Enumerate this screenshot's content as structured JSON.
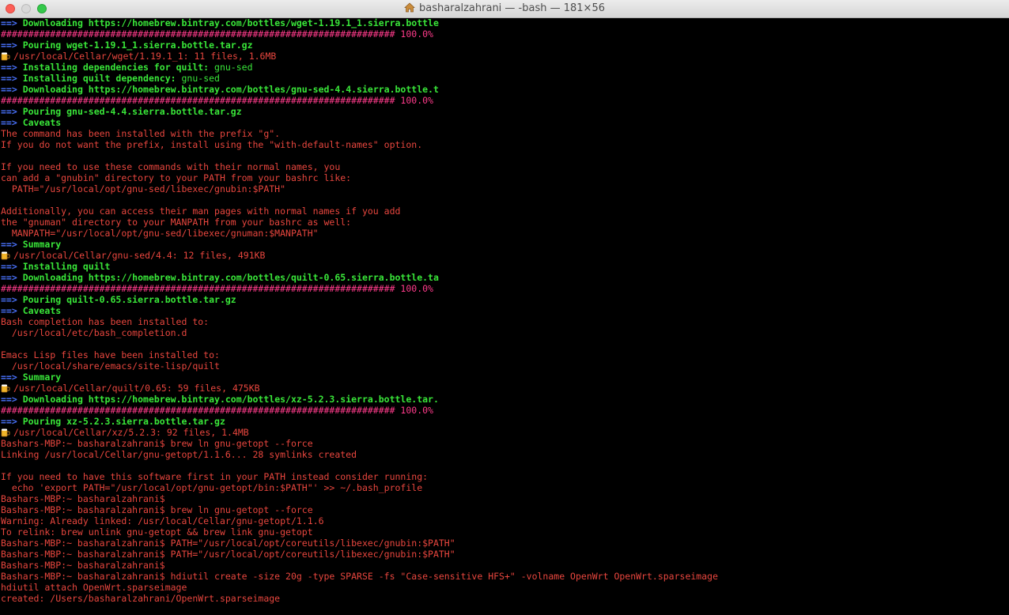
{
  "window": {
    "title": "basharalzahrani — -bash — 181×56"
  },
  "lines": [
    {
      "type": "arrow-green",
      "text": "Downloading https://homebrew.bintray.com/bottles/wget-1.19.1_1.sierra.bottle"
    },
    {
      "type": "hash",
      "text": "######################################################################## 100.0%"
    },
    {
      "type": "arrow-green",
      "text": "Pouring wget-1.19.1_1.sierra.bottle.tar.gz"
    },
    {
      "type": "beer",
      "text": "/usr/local/Cellar/wget/1.19.1_1: 11 files, 1.6MB"
    },
    {
      "type": "arrow-green-mixed",
      "text": "Installing dependencies for quilt:",
      "rest": " gnu-sed"
    },
    {
      "type": "arrow-green-mixed",
      "text": "Installing quilt dependency:",
      "rest": " gnu-sed"
    },
    {
      "type": "arrow-green",
      "text": "Downloading https://homebrew.bintray.com/bottles/gnu-sed-4.4.sierra.bottle.t"
    },
    {
      "type": "hash",
      "text": "######################################################################## 100.0%"
    },
    {
      "type": "arrow-green",
      "text": "Pouring gnu-sed-4.4.sierra.bottle.tar.gz"
    },
    {
      "type": "arrow-green",
      "text": "Caveats"
    },
    {
      "type": "red",
      "text": "The command has been installed with the prefix \"g\"."
    },
    {
      "type": "red",
      "text": "If you do not want the prefix, install using the \"with-default-names\" option."
    },
    {
      "type": "red",
      "text": ""
    },
    {
      "type": "red",
      "text": "If you need to use these commands with their normal names, you"
    },
    {
      "type": "red",
      "text": "can add a \"gnubin\" directory to your PATH from your bashrc like:"
    },
    {
      "type": "red",
      "text": "  PATH=\"/usr/local/opt/gnu-sed/libexec/gnubin:$PATH\""
    },
    {
      "type": "red",
      "text": ""
    },
    {
      "type": "red",
      "text": "Additionally, you can access their man pages with normal names if you add"
    },
    {
      "type": "red",
      "text": "the \"gnuman\" directory to your MANPATH from your bashrc as well:"
    },
    {
      "type": "red",
      "text": "  MANPATH=\"/usr/local/opt/gnu-sed/libexec/gnuman:$MANPATH\""
    },
    {
      "type": "arrow-green",
      "text": "Summary"
    },
    {
      "type": "beer",
      "text": "/usr/local/Cellar/gnu-sed/4.4: 12 files, 491KB"
    },
    {
      "type": "arrow-green",
      "text": "Installing quilt"
    },
    {
      "type": "arrow-green",
      "text": "Downloading https://homebrew.bintray.com/bottles/quilt-0.65.sierra.bottle.ta"
    },
    {
      "type": "hash",
      "text": "######################################################################## 100.0%"
    },
    {
      "type": "arrow-green",
      "text": "Pouring quilt-0.65.sierra.bottle.tar.gz"
    },
    {
      "type": "arrow-green",
      "text": "Caveats"
    },
    {
      "type": "red",
      "text": "Bash completion has been installed to:"
    },
    {
      "type": "red",
      "text": "  /usr/local/etc/bash_completion.d"
    },
    {
      "type": "red",
      "text": ""
    },
    {
      "type": "red",
      "text": "Emacs Lisp files have been installed to:"
    },
    {
      "type": "red",
      "text": "  /usr/local/share/emacs/site-lisp/quilt"
    },
    {
      "type": "arrow-green",
      "text": "Summary"
    },
    {
      "type": "beer",
      "text": "/usr/local/Cellar/quilt/0.65: 59 files, 475KB"
    },
    {
      "type": "arrow-green",
      "text": "Downloading https://homebrew.bintray.com/bottles/xz-5.2.3.sierra.bottle.tar."
    },
    {
      "type": "hash",
      "text": "######################################################################## 100.0%"
    },
    {
      "type": "arrow-green",
      "text": "Pouring xz-5.2.3.sierra.bottle.tar.gz"
    },
    {
      "type": "beer",
      "text": "/usr/local/Cellar/xz/5.2.3: 92 files, 1.4MB"
    },
    {
      "type": "red",
      "text": "Bashars-MBP:~ basharalzahrani$ brew ln gnu-getopt --force"
    },
    {
      "type": "red",
      "text": "Linking /usr/local/Cellar/gnu-getopt/1.1.6... 28 symlinks created"
    },
    {
      "type": "red",
      "text": ""
    },
    {
      "type": "red",
      "text": "If you need to have this software first in your PATH instead consider running:"
    },
    {
      "type": "red",
      "text": "  echo 'export PATH=\"/usr/local/opt/gnu-getopt/bin:$PATH\"' >> ~/.bash_profile"
    },
    {
      "type": "red",
      "text": "Bashars-MBP:~ basharalzahrani$"
    },
    {
      "type": "red",
      "text": "Bashars-MBP:~ basharalzahrani$ brew ln gnu-getopt --force"
    },
    {
      "type": "red",
      "text": "Warning: Already linked: /usr/local/Cellar/gnu-getopt/1.1.6"
    },
    {
      "type": "red",
      "text": "To relink: brew unlink gnu-getopt && brew link gnu-getopt"
    },
    {
      "type": "red",
      "text": "Bashars-MBP:~ basharalzahrani$ PATH=\"/usr/local/opt/coreutils/libexec/gnubin:$PATH\""
    },
    {
      "type": "red",
      "text": "Bashars-MBP:~ basharalzahrani$ PATH=\"/usr/local/opt/coreutils/libexec/gnubin:$PATH\""
    },
    {
      "type": "red",
      "text": "Bashars-MBP:~ basharalzahrani$"
    },
    {
      "type": "red",
      "text": "Bashars-MBP:~ basharalzahrani$ hdiutil create -size 20g -type SPARSE -fs \"Case-sensitive HFS+\" -volname OpenWrt OpenWrt.sparseimage"
    },
    {
      "type": "red",
      "text": "hdiutil attach OpenWrt.sparseimage"
    },
    {
      "type": "red",
      "text": "created: /Users/basharalzahrani/OpenWrt.sparseimage"
    }
  ],
  "arrow_glyph": "==>",
  "icons": {
    "beer": "beer-mug-icon",
    "home": "home-icon"
  },
  "colors": {
    "background": "#000000",
    "arrow": "#4a73ff",
    "green": "#39e639",
    "red": "#e8463e",
    "hash": "#ff3b8b"
  }
}
